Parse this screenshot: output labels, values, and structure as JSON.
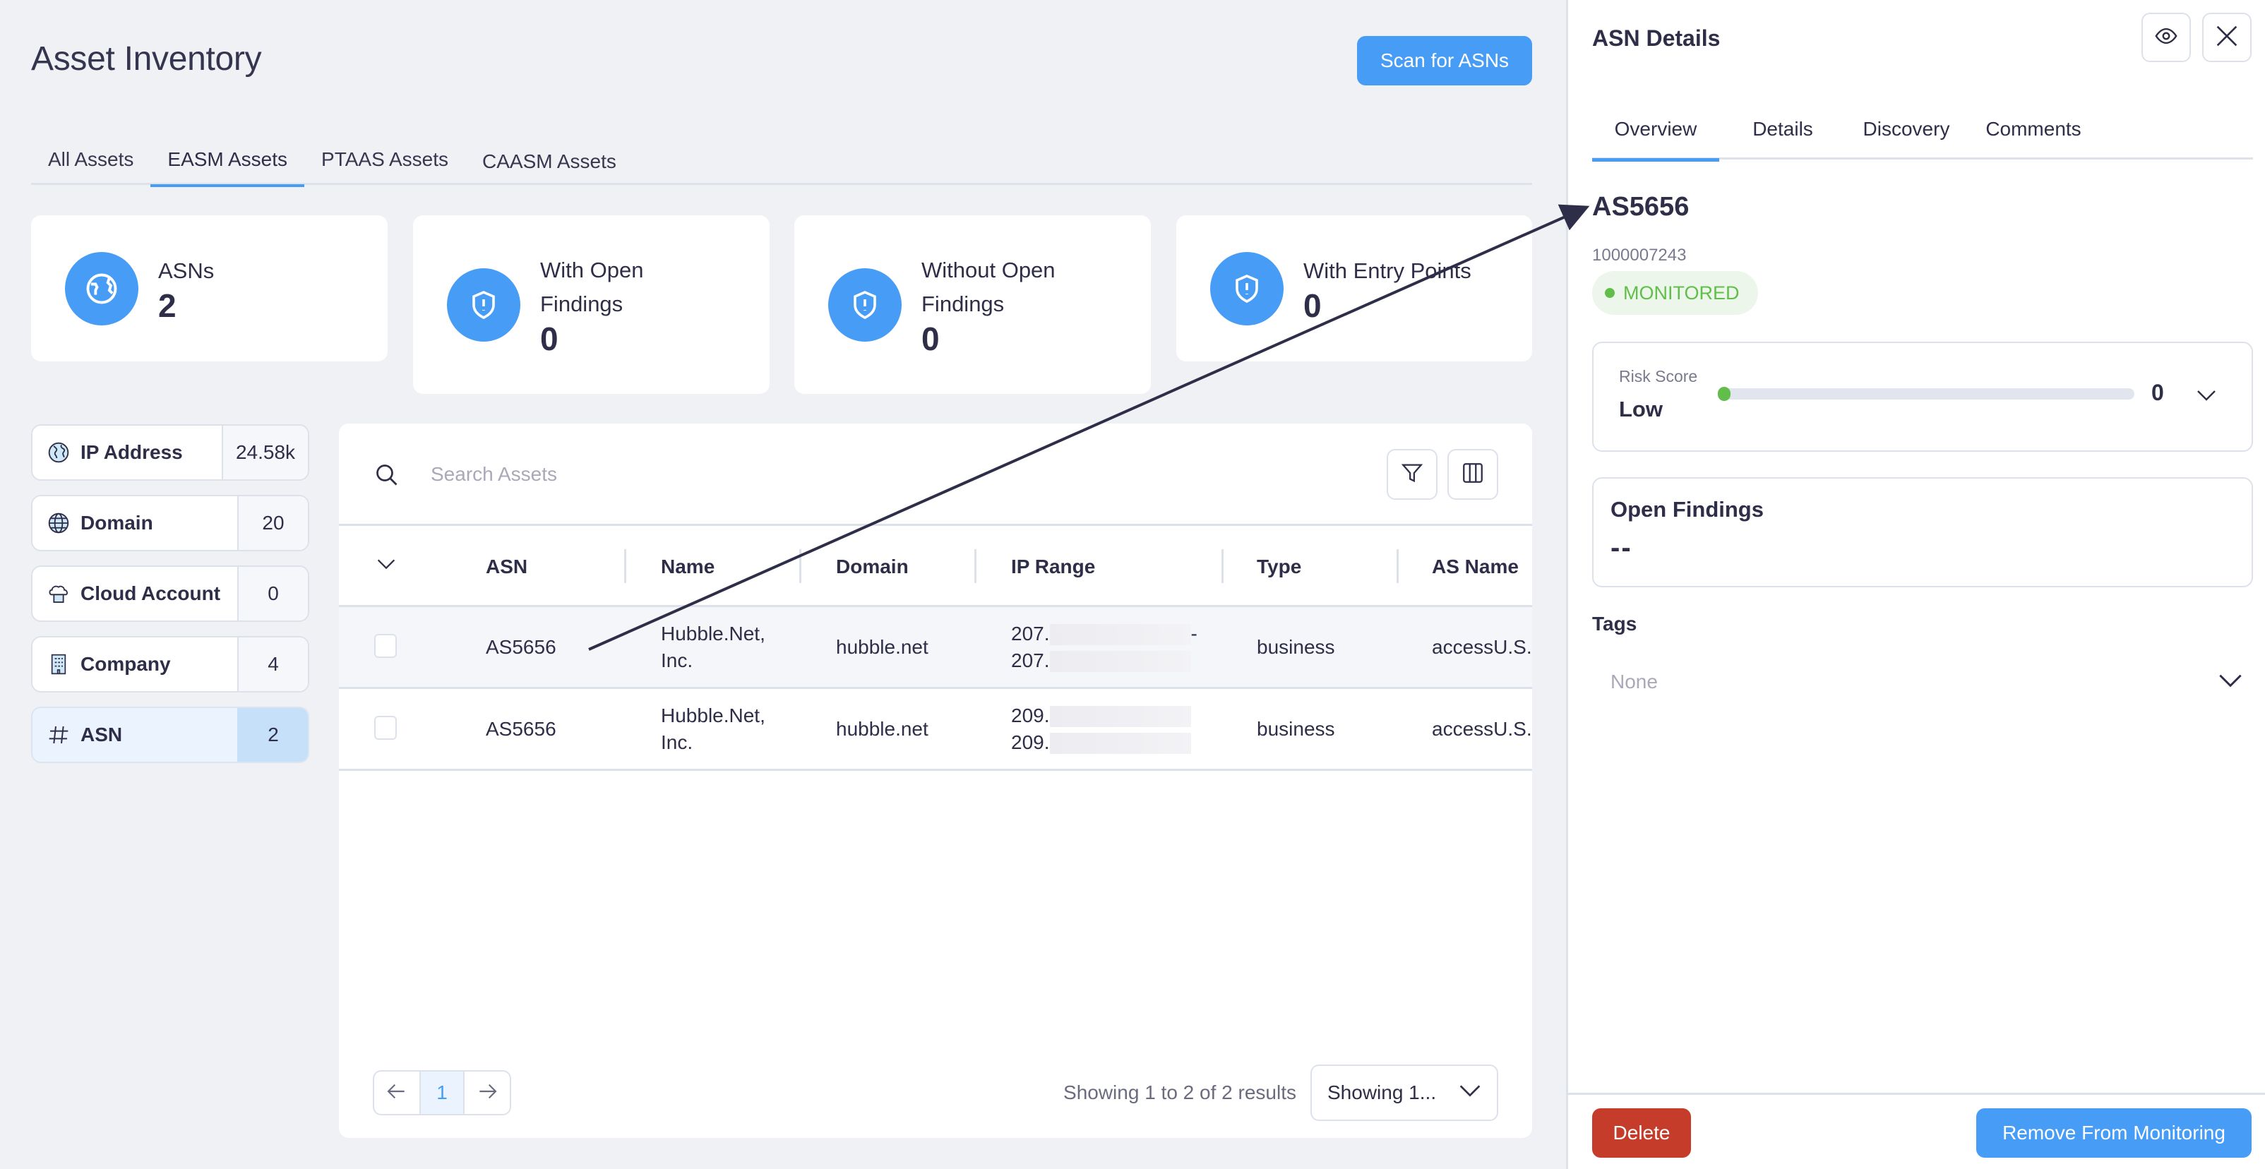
{
  "header": {
    "title": "Asset Inventory",
    "scan_button": "Scan for ASNs"
  },
  "tabs": [
    {
      "label": "All Assets",
      "active": false
    },
    {
      "label": "EASM Assets",
      "active": true
    },
    {
      "label": "PTAAS Assets",
      "active": false
    },
    {
      "label": "CAASM Assets",
      "active": false
    }
  ],
  "stats": [
    {
      "label": "ASNs",
      "value": "2",
      "icon": "globe-icon"
    },
    {
      "label": "With Open Findings",
      "value": "0",
      "icon": "shield-alert-icon"
    },
    {
      "label": "Without Open Findings",
      "value": "0",
      "icon": "shield-alert-icon"
    },
    {
      "label": "With Entry Points",
      "value": "0",
      "icon": "shield-alert-icon"
    }
  ],
  "asset_types": [
    {
      "label": "IP Address",
      "count": "24.58k",
      "icon": "ip-globe-icon",
      "active": false
    },
    {
      "label": "Domain",
      "count": "20",
      "icon": "domain-globe-icon",
      "active": false
    },
    {
      "label": "Cloud Account",
      "count": "0",
      "icon": "cloud-account-icon",
      "active": false
    },
    {
      "label": "Company",
      "count": "4",
      "icon": "building-icon",
      "active": false
    },
    {
      "label": "ASN",
      "count": "2",
      "icon": "hash-icon",
      "active": true
    }
  ],
  "table": {
    "search_placeholder": "Search Assets",
    "columns": [
      "ASN",
      "Name",
      "Domain",
      "IP Range",
      "Type",
      "AS Name"
    ],
    "rows": [
      {
        "asn": "AS5656",
        "name_line1": "Hubble.Net,",
        "name_line2": "Inc.",
        "domain": "hubble.net",
        "ip_line1": "207.",
        "ip_line1_suffix": "-",
        "ip_line2": "207.",
        "type": "business",
        "as_name": "accessU.S.,",
        "selected": true
      },
      {
        "asn": "AS5656",
        "name_line1": "Hubble.Net,",
        "name_line2": "Inc.",
        "domain": "hubble.net",
        "ip_line1": "209.",
        "ip_line1_suffix": "",
        "ip_line2": "209.",
        "type": "business",
        "as_name": "accessU.S.,",
        "selected": false
      }
    ],
    "pagination": {
      "current_page": "1",
      "results_text": "Showing 1 to 2 of 2 results",
      "page_size_label": "Showing 1..."
    }
  },
  "panel": {
    "title": "ASN Details",
    "tabs": [
      {
        "label": "Overview",
        "active": true
      },
      {
        "label": "Details",
        "active": false
      },
      {
        "label": "Discovery",
        "active": false
      },
      {
        "label": "Comments",
        "active": false
      }
    ],
    "asn": "AS5656",
    "asn_id": "1000007243",
    "status": "MONITORED",
    "risk": {
      "label": "Risk Score",
      "level": "Low",
      "value": "0",
      "fraction": 0.0
    },
    "open_findings": {
      "label": "Open Findings",
      "value": "--"
    },
    "tags": {
      "label": "Tags",
      "placeholder": "None"
    },
    "delete_button": "Delete",
    "remove_button": "Remove From Monitoring"
  },
  "colors": {
    "accent": "#479cf6",
    "danger": "#c63c2a",
    "success": "#62be4a",
    "text": "#2f2e48",
    "background": "#eff1f5"
  }
}
